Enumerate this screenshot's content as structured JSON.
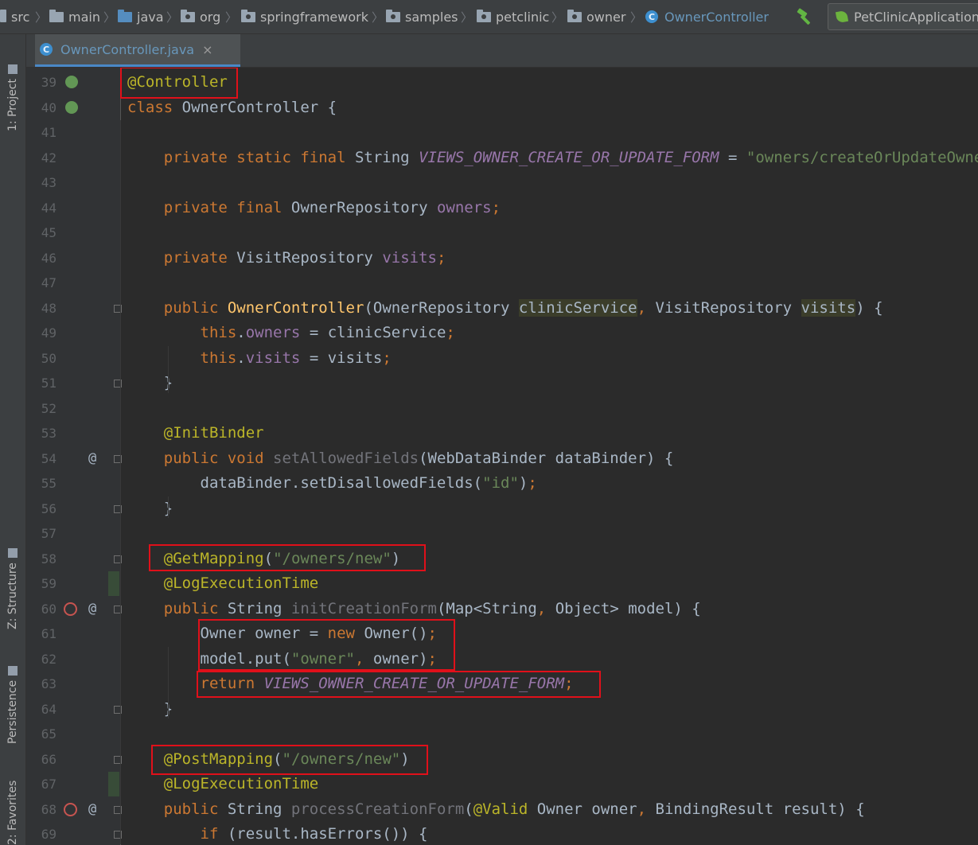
{
  "breadcrumb": {
    "items": [
      {
        "label": "src",
        "icon": "folder-icon"
      },
      {
        "label": "main",
        "icon": "folder-icon"
      },
      {
        "label": "java",
        "icon": "source-folder-icon"
      },
      {
        "label": "org",
        "icon": "package-icon"
      },
      {
        "label": "springframework",
        "icon": "package-icon"
      },
      {
        "label": "samples",
        "icon": "package-icon"
      },
      {
        "label": "petclinic",
        "icon": "package-icon"
      },
      {
        "label": "owner",
        "icon": "package-icon"
      },
      {
        "label": "OwnerController",
        "icon": "class-icon"
      }
    ],
    "run_config": "PetClinicApplication"
  },
  "toolstrip": {
    "project": "1: Project",
    "structure": "Z: Structure",
    "persistence": "Persistence",
    "favorites": "2: Favorites"
  },
  "tab": {
    "filename": "OwnerController.java",
    "close": "×"
  },
  "gutter": {
    "at_marker": "@"
  },
  "editor": {
    "line_numbers": [
      "39",
      "40",
      "41",
      "42",
      "43",
      "44",
      "45",
      "46",
      "47",
      "48",
      "49",
      "50",
      "51",
      "52",
      "53",
      "54",
      "55",
      "56",
      "57",
      "58",
      "59",
      "60",
      "61",
      "62",
      "63",
      "64",
      "65",
      "66",
      "67",
      "68",
      "69"
    ],
    "lines": [
      {
        "n": "39",
        "seg": [
          {
            "c": "an",
            "t": "@Controller"
          }
        ]
      },
      {
        "n": "40",
        "seg": [
          {
            "c": "kw",
            "t": "class "
          },
          {
            "c": "",
            "t": "OwnerController {"
          }
        ]
      },
      {
        "n": "41",
        "seg": []
      },
      {
        "n": "42",
        "seg": [
          {
            "c": "",
            "t": "    "
          },
          {
            "c": "kw",
            "t": "private static final "
          },
          {
            "c": "",
            "t": "String "
          },
          {
            "c": "cs",
            "t": "VIEWS_OWNER_CREATE_OR_UPDATE_FORM"
          },
          {
            "c": "",
            "t": " = "
          },
          {
            "c": "st",
            "t": "\"owners/createOrUpdateOwnerForm\""
          },
          {
            "c": "kw",
            "t": ";"
          }
        ]
      },
      {
        "n": "43",
        "seg": []
      },
      {
        "n": "44",
        "seg": [
          {
            "c": "",
            "t": "    "
          },
          {
            "c": "kw",
            "t": "private final "
          },
          {
            "c": "",
            "t": "OwnerRepository "
          },
          {
            "c": "fi",
            "t": "owners"
          },
          {
            "c": "kw",
            "t": ";"
          }
        ]
      },
      {
        "n": "45",
        "seg": []
      },
      {
        "n": "46",
        "seg": [
          {
            "c": "",
            "t": "    "
          },
          {
            "c": "kw",
            "t": "private "
          },
          {
            "c": "",
            "t": "VisitRepository "
          },
          {
            "c": "fi",
            "t": "visits"
          },
          {
            "c": "kw",
            "t": ";"
          }
        ]
      },
      {
        "n": "47",
        "seg": []
      },
      {
        "n": "48",
        "seg": [
          {
            "c": "",
            "t": "    "
          },
          {
            "c": "kw",
            "t": "public "
          },
          {
            "c": "fn",
            "t": "OwnerController"
          },
          {
            "c": "",
            "t": "(OwnerRepository "
          },
          {
            "c": "hl",
            "t": "clinicService"
          },
          {
            "c": "kw",
            "t": ", "
          },
          {
            "c": "",
            "t": "VisitRepository "
          },
          {
            "c": "hl",
            "t": "visits"
          },
          {
            "c": "",
            "t": ") {"
          }
        ]
      },
      {
        "n": "49",
        "seg": [
          {
            "c": "",
            "t": "        "
          },
          {
            "c": "kw",
            "t": "this"
          },
          {
            "c": "",
            "t": "."
          },
          {
            "c": "fi",
            "t": "owners"
          },
          {
            "c": "",
            "t": " = clinicService"
          },
          {
            "c": "kw",
            "t": ";"
          }
        ]
      },
      {
        "n": "50",
        "seg": [
          {
            "c": "",
            "t": "        "
          },
          {
            "c": "kw",
            "t": "this"
          },
          {
            "c": "",
            "t": "."
          },
          {
            "c": "fi",
            "t": "visits"
          },
          {
            "c": "",
            "t": " = visits"
          },
          {
            "c": "kw",
            "t": ";"
          }
        ]
      },
      {
        "n": "51",
        "seg": [
          {
            "c": "",
            "t": "    }"
          }
        ]
      },
      {
        "n": "52",
        "seg": []
      },
      {
        "n": "53",
        "seg": [
          {
            "c": "",
            "t": "    "
          },
          {
            "c": "an",
            "t": "@InitBinder"
          }
        ]
      },
      {
        "n": "54",
        "seg": [
          {
            "c": "",
            "t": "    "
          },
          {
            "c": "kw",
            "t": "public void "
          },
          {
            "c": "mu",
            "t": "setAllowedFields"
          },
          {
            "c": "",
            "t": "(WebDataBinder dataBinder) {"
          }
        ]
      },
      {
        "n": "55",
        "seg": [
          {
            "c": "",
            "t": "        dataBinder.setDisallowedFields("
          },
          {
            "c": "st",
            "t": "\"id\""
          },
          {
            "c": "",
            "t": ")"
          },
          {
            "c": "kw",
            "t": ";"
          }
        ]
      },
      {
        "n": "56",
        "seg": [
          {
            "c": "",
            "t": "    }"
          }
        ]
      },
      {
        "n": "57",
        "seg": []
      },
      {
        "n": "58",
        "seg": [
          {
            "c": "",
            "t": "    "
          },
          {
            "c": "an",
            "t": "@GetMapping"
          },
          {
            "c": "",
            "t": "("
          },
          {
            "c": "st",
            "t": "\"/owners/new\""
          },
          {
            "c": "",
            "t": ")"
          }
        ]
      },
      {
        "n": "59",
        "seg": [
          {
            "c": "",
            "t": "    "
          },
          {
            "c": "an",
            "t": "@LogExecutionTime"
          }
        ]
      },
      {
        "n": "60",
        "seg": [
          {
            "c": "",
            "t": "    "
          },
          {
            "c": "kw",
            "t": "public "
          },
          {
            "c": "",
            "t": "String "
          },
          {
            "c": "mu",
            "t": "initCreationForm"
          },
          {
            "c": "",
            "t": "(Map<String"
          },
          {
            "c": "kw",
            "t": ", "
          },
          {
            "c": "",
            "t": "Object> model) {"
          }
        ]
      },
      {
        "n": "61",
        "seg": [
          {
            "c": "",
            "t": "        Owner owner = "
          },
          {
            "c": "kw",
            "t": "new "
          },
          {
            "c": "",
            "t": "Owner()"
          },
          {
            "c": "kw",
            "t": ";"
          }
        ]
      },
      {
        "n": "62",
        "seg": [
          {
            "c": "",
            "t": "        model.put("
          },
          {
            "c": "st",
            "t": "\"owner\""
          },
          {
            "c": "kw",
            "t": ", "
          },
          {
            "c": "",
            "t": "owner)"
          },
          {
            "c": "kw",
            "t": ";"
          }
        ]
      },
      {
        "n": "63",
        "seg": [
          {
            "c": "",
            "t": "        "
          },
          {
            "c": "kw",
            "t": "return "
          },
          {
            "c": "cs",
            "t": "VIEWS_OWNER_CREATE_OR_UPDATE_FORM"
          },
          {
            "c": "kw",
            "t": ";"
          }
        ]
      },
      {
        "n": "64",
        "seg": [
          {
            "c": "",
            "t": "    }"
          }
        ]
      },
      {
        "n": "65",
        "seg": []
      },
      {
        "n": "66",
        "seg": [
          {
            "c": "",
            "t": "    "
          },
          {
            "c": "an",
            "t": "@PostMapping"
          },
          {
            "c": "",
            "t": "("
          },
          {
            "c": "st",
            "t": "\"/owners/new\""
          },
          {
            "c": "",
            "t": ")"
          }
        ]
      },
      {
        "n": "67",
        "seg": [
          {
            "c": "",
            "t": "    "
          },
          {
            "c": "an",
            "t": "@LogExecutionTime"
          }
        ]
      },
      {
        "n": "68",
        "seg": [
          {
            "c": "",
            "t": "    "
          },
          {
            "c": "kw",
            "t": "public "
          },
          {
            "c": "",
            "t": "String "
          },
          {
            "c": "mu",
            "t": "processCreationForm"
          },
          {
            "c": "",
            "t": "("
          },
          {
            "c": "an",
            "t": "@Valid "
          },
          {
            "c": "",
            "t": "Owner owner"
          },
          {
            "c": "kw",
            "t": ", "
          },
          {
            "c": "",
            "t": "BindingResult result) {"
          }
        ]
      },
      {
        "n": "69",
        "seg": [
          {
            "c": "",
            "t": "        "
          },
          {
            "c": "kw",
            "t": "if "
          },
          {
            "c": "",
            "t": "(result.hasErrors()) {"
          }
        ]
      }
    ]
  },
  "colors": {
    "highlight_box": "#e0101a",
    "keyword": "#cc7832",
    "annotation": "#bbb529",
    "string": "#6a8759",
    "field": "#9876aa"
  }
}
